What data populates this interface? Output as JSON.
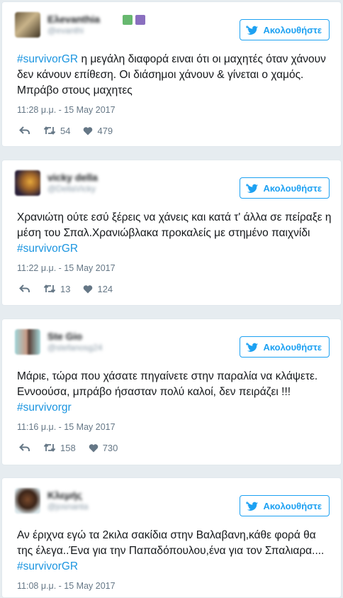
{
  "follow_label": "Ακολουθήστε",
  "colors": {
    "accent": "#1da1f2",
    "hashtag": "#1b95e0",
    "meta": "#657786"
  },
  "icons": {
    "follow": "bird-plus-icon",
    "reply": "reply-icon",
    "retweet": "retweet-icon",
    "like": "heart-icon"
  },
  "tweets": [
    {
      "display_name": "Ελevanthia",
      "handle": "@evanthi",
      "text_before": "",
      "hashtag_lead": "#survivorGR",
      "text_after": " η μεγάλη διαφορά ειναι ότι οι μαχητές όταν χάνουν\nδεν κάνουν επίθεση. Οι διάσημοι χάνουν & γίνεται ο χαμός.\nΜπράβο στους μαχητες",
      "time": "11:28 μ.μ. - 15 May 2017",
      "retweets": "54",
      "likes": "479"
    },
    {
      "display_name": "vicky della",
      "handle": "@DellaVicky",
      "text_before": "Χρανιώτη ούτε εσύ ξέρεις να χάνεις και κατά τ' άλλα σε πείραξε η\nμέση του Σπαλ.Χρανιώβλακα προκαλείς με στημένο παιχνίδι\n",
      "hashtag_tail": "#survivorGR",
      "time": "11:22 μ.μ. - 15 May 2017",
      "retweets": "13",
      "likes": "124"
    },
    {
      "display_name": "Ste Gio",
      "handle": "@stefanosg24",
      "text_before": "Μάριε, τώρα που χάσατε πηγαίνετε στην παραλία να κλάψετε.\nΕννοούσα, μπράβο ήσασταν πολύ καλοί, δεν πειράζει !!!\n",
      "hashtag_tail": "#survivorgr",
      "time": "11:16 μ.μ. - 15 May 2017",
      "retweets": "158",
      "likes": "730"
    },
    {
      "display_name": "Κλεμής",
      "handle": "@josnanta",
      "text_before": "Αν έριχνα εγώ τα 2κιλα σακίδια στην Βαλαβανη,κάθε φορά θα\nτης έλεγα..Ένα για την Παπαδόπουλου,ένα για τον Σπαλιαρα....\n",
      "hashtag_tail": "#survivorGR",
      "time": "11:08 μ.μ. - 15 May 2017"
    }
  ]
}
